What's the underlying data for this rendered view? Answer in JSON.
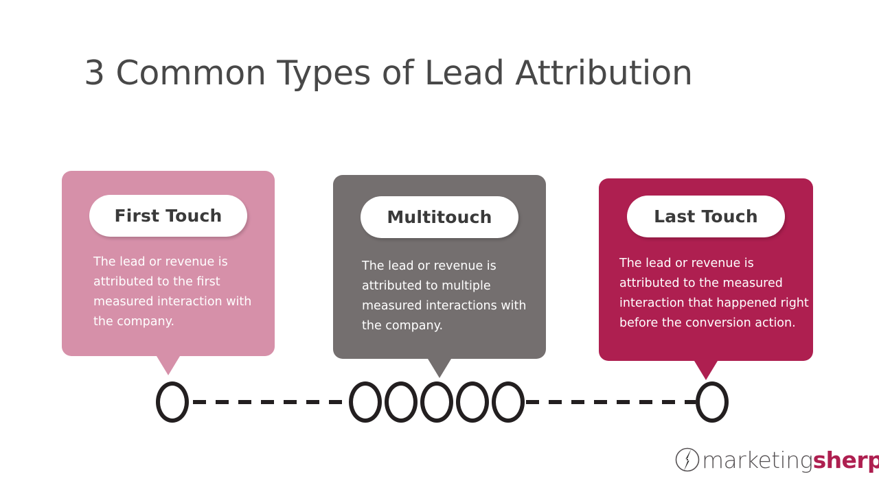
{
  "slide": {
    "title": "3 Common Types of Lead Attribution",
    "background_color": "#ffffff",
    "title_color": "#484848"
  },
  "cards": [
    {
      "id": "first",
      "pill_label": "First Touch",
      "body": "The lead or revenue is attributed to the first measured interaction with the company.",
      "color": "#d690a9",
      "text_color": "#ffffff"
    },
    {
      "id": "multi",
      "pill_label": "Multitouch",
      "body": "The lead or revenue is attributed to multiple measured interactions with the company.",
      "color": "#746f6f",
      "text_color": "#ffffff"
    },
    {
      "id": "last",
      "pill_label": "Last Touch",
      "body": "The lead or revenue is attributed to the measured interaction that happened right before the conversion action.",
      "color": "#ae1f50",
      "text_color": "#ffffff"
    }
  ],
  "timeline": {
    "node_color": "#231f20",
    "node_count": 7,
    "groups": [
      {
        "name": "first-touch-node",
        "count": 1
      },
      {
        "name": "multitouch-node-group",
        "count": 5
      },
      {
        "name": "last-touch-node",
        "count": 1
      }
    ],
    "connector_style": "dashed"
  },
  "logo": {
    "word_1": "marketing",
    "word_2": "sherpa",
    "word_1_color": "#555153",
    "word_2_color": "#ae1f50"
  }
}
